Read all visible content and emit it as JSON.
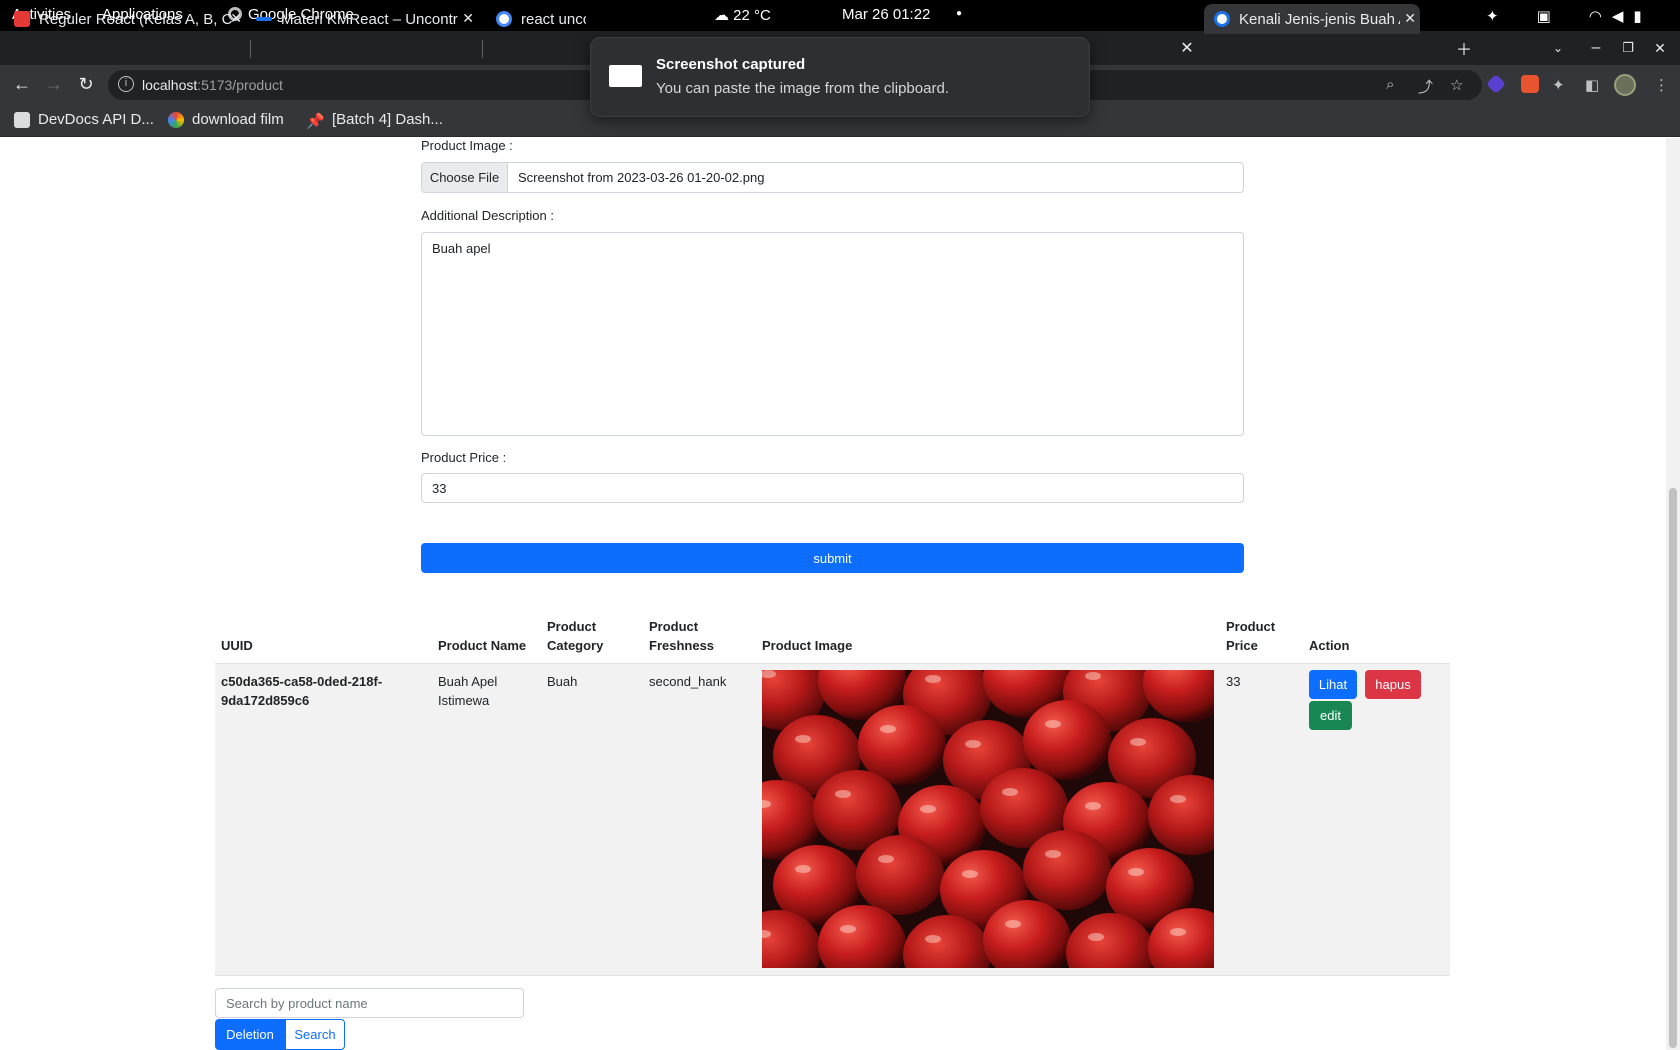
{
  "system_bar": {
    "activities": "Activities",
    "applications": "Applications",
    "app_name": "Google Chrome",
    "weather": "22 °C",
    "datetime": "Mar 26  01:22"
  },
  "tabs": [
    {
      "title": "Reguler React (Kelas A, B, C",
      "favicon_color": "#e53935"
    },
    {
      "title": "Materi KMReact – Uncontr",
      "favicon_color": "#1a73e8"
    },
    {
      "title": "react uncc",
      "favicon_color": "#4285f4"
    },
    {
      "title": "Kenali Jenis-jenis Buah Ap",
      "favicon_color": "#4285f4"
    }
  ],
  "address_bar": {
    "host": "localhost",
    "path": ":5173/product"
  },
  "bookmarks": [
    {
      "label": "DevDocs API D...",
      "color": "#5f6368"
    },
    {
      "label": "download film",
      "color": "#ea4335"
    },
    {
      "label": "[Batch 4] Dash...",
      "color": "#ea4335"
    }
  ],
  "notification": {
    "title": "Screenshot captured",
    "body": "You can paste the image from the clipboard."
  },
  "form": {
    "image_label": "Product Image :",
    "choose_file": "Choose File",
    "file_name": "Screenshot from 2023-03-26 01-20-02.png",
    "description_label": "Additional Description :",
    "description_value": "Buah apel",
    "price_label": "Product Price :",
    "price_value": "33",
    "submit_label": "submit"
  },
  "table": {
    "headers": {
      "uuid": "UUID",
      "name": "Product Name",
      "category_1": "Product",
      "category_2": "Category",
      "freshness_1": "Product",
      "freshness_2": "Freshness",
      "image": "Product Image",
      "price_1": "Product",
      "price_2": "Price",
      "action": "Action"
    },
    "rows": [
      {
        "uuid_1": "c50da365-ca58-0ded-218f-",
        "uuid_2": "9da172d859c6",
        "name_1": "Buah Apel",
        "name_2": "Istimewa",
        "category": "Buah",
        "freshness": "second_hank",
        "price": "33",
        "btn_view": "Lihat",
        "btn_delete": "hapus",
        "btn_edit": "edit"
      }
    ]
  },
  "search": {
    "placeholder": "Search by product name",
    "deletion_label": "Deletion",
    "search_label": "Search"
  },
  "colors": {
    "primary": "#0d6efd",
    "danger": "#dc3545",
    "success": "#198754"
  }
}
